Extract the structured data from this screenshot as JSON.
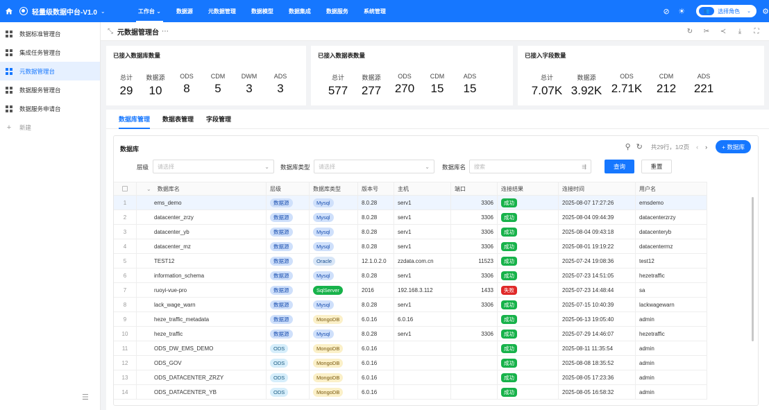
{
  "topbar": {
    "title": "轻量级数据中台-V1.0",
    "nav": [
      {
        "label": "工作台",
        "active": true,
        "dropdown": true
      },
      {
        "label": "数据源"
      },
      {
        "label": "元数据管理"
      },
      {
        "label": "数据模型"
      },
      {
        "label": "数据集成"
      },
      {
        "label": "数据服务"
      },
      {
        "label": "系统管理"
      }
    ],
    "role_label": "选择角色"
  },
  "sidebar": {
    "items": [
      {
        "label": "数据标准管理台"
      },
      {
        "label": "集成任务管理台"
      },
      {
        "label": "元数据管理台",
        "active": true
      },
      {
        "label": "数据服务管理台"
      },
      {
        "label": "数据服务申请台"
      }
    ],
    "new_label": "新建"
  },
  "page": {
    "title": "元数据管理台"
  },
  "cards": [
    {
      "title": "已接入数据库数量",
      "stats": [
        {
          "label": "总计",
          "value": "29"
        },
        {
          "label": "数据源",
          "value": "10"
        },
        {
          "label": "ODS",
          "value": "8"
        },
        {
          "label": "CDM",
          "value": "5"
        },
        {
          "label": "DWM",
          "value": "3"
        },
        {
          "label": "ADS",
          "value": "3"
        }
      ]
    },
    {
      "title": "已接入数据表数量",
      "stats": [
        {
          "label": "总计",
          "value": "577"
        },
        {
          "label": "数据源",
          "value": "277"
        },
        {
          "label": "ODS",
          "value": "270"
        },
        {
          "label": "CDM",
          "value": "15"
        },
        {
          "label": "ADS",
          "value": "15"
        }
      ]
    },
    {
      "title": "已接入字段数量",
      "stats": [
        {
          "label": "总计",
          "value": "7.07K"
        },
        {
          "label": "数据源",
          "value": "3.92K"
        },
        {
          "label": "ODS",
          "value": "2.71K"
        },
        {
          "label": "CDM",
          "value": "212"
        },
        {
          "label": "ADS",
          "value": "221"
        }
      ]
    }
  ],
  "tabs": [
    {
      "label": "数据库管理",
      "active": true
    },
    {
      "label": "数据表管理"
    },
    {
      "label": "字段管理"
    }
  ],
  "panel": {
    "title": "数据库",
    "page_info": "共29行，1/2页",
    "add_label": "+ 数据库",
    "filters": {
      "level_label": "层级",
      "level_placeholder": "请选择",
      "type_label": "数据库类型",
      "type_placeholder": "请选择",
      "name_label": "数据库名",
      "name_placeholder": "搜索",
      "query_label": "查询",
      "reset_label": "重置"
    }
  },
  "table": {
    "columns": [
      "数据库名",
      "层级",
      "数据库类型",
      "版本号",
      "主机",
      "端口",
      "连接结果",
      "连接时间",
      "用户名"
    ],
    "rows": [
      {
        "no": "1",
        "name": "ems_demo",
        "level": "数据源",
        "type": "Mysql",
        "ver": "8.0.28",
        "host": "serv1",
        "port": "3306",
        "result": "成功",
        "time": "2025-08-07 17:27:26",
        "user": "emsdemo"
      },
      {
        "no": "2",
        "name": "datacenter_zrzy",
        "level": "数据源",
        "type": "Mysql",
        "ver": "8.0.28",
        "host": "serv1",
        "port": "3306",
        "result": "成功",
        "time": "2025-08-04 09:44:39",
        "user": "datacenterzrzy"
      },
      {
        "no": "3",
        "name": "datacenter_yb",
        "level": "数据源",
        "type": "Mysql",
        "ver": "8.0.28",
        "host": "serv1",
        "port": "3306",
        "result": "成功",
        "time": "2025-08-04 09:43:18",
        "user": "datacenteryb"
      },
      {
        "no": "4",
        "name": "datacenter_mz",
        "level": "数据源",
        "type": "Mysql",
        "ver": "8.0.28",
        "host": "serv1",
        "port": "3306",
        "result": "成功",
        "time": "2025-08-01 19:19:22",
        "user": "datacentermz"
      },
      {
        "no": "5",
        "name": "TEST12",
        "level": "数据源",
        "type": "Oracle",
        "ver": "12.1.0.2.0",
        "host": "zzdata.com.cn",
        "port": "11523",
        "result": "成功",
        "time": "2025-07-24 19:08:36",
        "user": "test12"
      },
      {
        "no": "6",
        "name": "information_schema",
        "level": "数据源",
        "type": "Mysql",
        "ver": "8.0.28",
        "host": "serv1",
        "port": "3306",
        "result": "成功",
        "time": "2025-07-23 14:51:05",
        "user": "hezetraffic"
      },
      {
        "no": "7",
        "name": "ruoyi-vue-pro",
        "level": "数据源",
        "type": "SqlServer",
        "ver": "2016",
        "host": "192.168.3.112",
        "port": "1433",
        "result": "失败",
        "time": "2025-07-23 14:48:44",
        "user": "sa"
      },
      {
        "no": "8",
        "name": "lack_wage_warn",
        "level": "数据源",
        "type": "Mysql",
        "ver": "8.0.28",
        "host": "serv1",
        "port": "3306",
        "result": "成功",
        "time": "2025-07-15 10:40:39",
        "user": "lackwagewarn"
      },
      {
        "no": "9",
        "name": "heze_traffic_metadata",
        "level": "数据源",
        "type": "MongoDB",
        "ver": "6.0.16",
        "host": "6.0.16",
        "port": "",
        "result": "成功",
        "time": "2025-06-13 19:05:40",
        "user": "admin"
      },
      {
        "no": "10",
        "name": "heze_traffic",
        "level": "数据源",
        "type": "Mysql",
        "ver": "8.0.28",
        "host": "serv1",
        "port": "3306",
        "result": "成功",
        "time": "2025-07-29 14:46:07",
        "user": "hezetraffic"
      },
      {
        "no": "11",
        "name": "ODS_DW_EMS_DEMO",
        "level": "ODS",
        "type": "MongoDB",
        "ver": "6.0.16",
        "host": "",
        "port": "",
        "result": "成功",
        "time": "2025-08-11 11:35:54",
        "user": "admin"
      },
      {
        "no": "12",
        "name": "ODS_GOV",
        "level": "ODS",
        "type": "MongoDB",
        "ver": "6.0.16",
        "host": "",
        "port": "",
        "result": "成功",
        "time": "2025-08-08 18:35:52",
        "user": "admin"
      },
      {
        "no": "13",
        "name": "ODS_DATACENTER_ZRZY",
        "level": "ODS",
        "type": "MongoDB",
        "ver": "6.0.16",
        "host": "",
        "port": "",
        "result": "成功",
        "time": "2025-08-05 17:23:36",
        "user": "admin"
      },
      {
        "no": "14",
        "name": "ODS_DATACENTER_YB",
        "level": "ODS",
        "type": "MongoDB",
        "ver": "6.0.16",
        "host": "",
        "port": "",
        "result": "成功",
        "time": "2025-08-05 16:58:32",
        "user": "admin"
      }
    ]
  },
  "colors": {
    "primary": "#1677ff",
    "success": "#17b24a",
    "danger": "#e02929"
  }
}
